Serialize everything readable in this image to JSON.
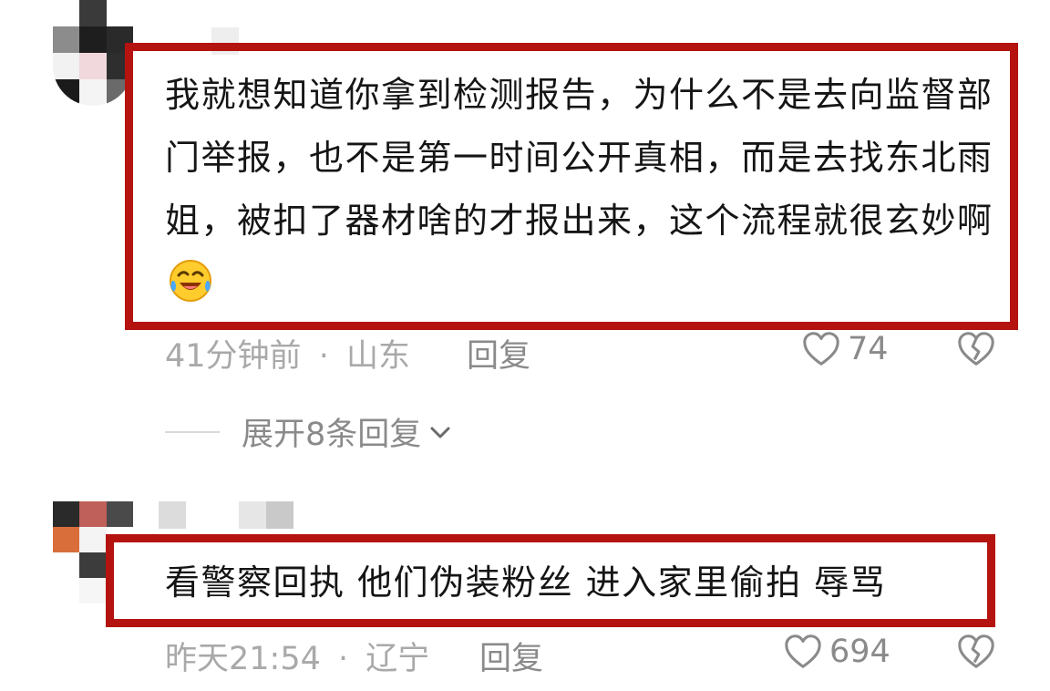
{
  "comments": [
    {
      "text": "我就想知道你拿到检测报告，为什么不是去向监督部门举报，也不是第一时间公开真相，而是去找东北雨姐，被扣了器材啥的才报出来，这个流程就很玄妙啊",
      "emoji": "rofl-emoji",
      "time": "41分钟前",
      "separator": "·",
      "location": "山东",
      "reply_label": "回复",
      "likes": "74",
      "expand_label": "展开8条回复"
    },
    {
      "text": "看警察回执 他们伪装粉丝 进入家里偷拍 辱骂",
      "time": "昨天21:54",
      "separator": "·",
      "location": "辽宁",
      "reply_label": "回复",
      "likes": "694"
    }
  ],
  "colors": {
    "highlight_border": "#b4130f",
    "text": "#151515",
    "meta": "#a9a9a9",
    "action": "#8a8a8a"
  },
  "icons": [
    "heart-outline-icon",
    "broken-heart-icon",
    "chevron-down-icon"
  ]
}
